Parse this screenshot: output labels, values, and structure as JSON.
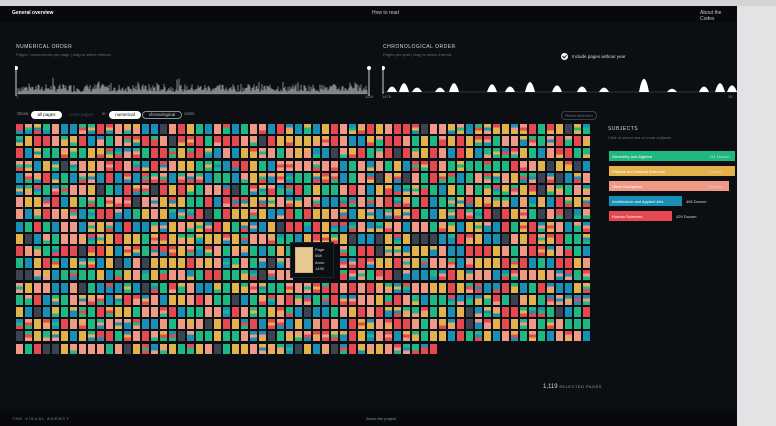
{
  "topbar": {
    "left": "General overview",
    "middle": "How to read",
    "right": "About the Codex"
  },
  "numerical": {
    "title": "NUMERICAL ORDER",
    "hint": "Pages / occurrences per page  |  drag to select interval",
    "start": "1",
    "end": "1119"
  },
  "chronological": {
    "title": "CHRONOLOGICAL ORDER",
    "hint": "Pages per year  |  drag to select interval",
    "start": "1478",
    "end": "15"
  },
  "include_label": "Include pages without year",
  "controls": {
    "show": "Show",
    "all_pages": "all pages",
    "some_pages": "some pages",
    "in": "in",
    "numerical": "numerical",
    "chronological": "chronological",
    "order": "order",
    "reset": "Reset selection"
  },
  "tooltip": {
    "l1": "Page",
    "l2": "558",
    "l3": "Anno",
    "l4": "1490"
  },
  "subjects": {
    "title": "SUBJECTS",
    "hint": "Click to select one or more subjects",
    "items": [
      {
        "label": "Geometry and Algebra",
        "count": "741 Docum",
        "color": "#1fb882",
        "fill": 1.0
      },
      {
        "label": "Physics and Natural Sciences",
        "count": "Docum",
        "color": "#e4b24a",
        "fill": 1.0
      },
      {
        "label": "Other Disciplines",
        "count": "Docum",
        "color": "#f09a86",
        "fill": 0.95
      },
      {
        "label": "Architecture and Applied Arts",
        "count": "496 Docum",
        "color": "#1a8fb6",
        "fill": 0.58
      },
      {
        "label": "Human Sciences",
        "count": "429 Docum",
        "color": "#e5484f",
        "fill": 0.5
      }
    ]
  },
  "selected": {
    "count": "1,119",
    "label": "SELECTED PAGES"
  },
  "footer": {
    "left": "THE VISUAL AGENCY",
    "middle": "About the project"
  },
  "colors": {
    "bg": "#0b0f14",
    "green": "#1fb882",
    "yellow": "#e4b24a",
    "salmon": "#f09a86",
    "blue": "#1a8fb6",
    "red": "#e5484f"
  }
}
